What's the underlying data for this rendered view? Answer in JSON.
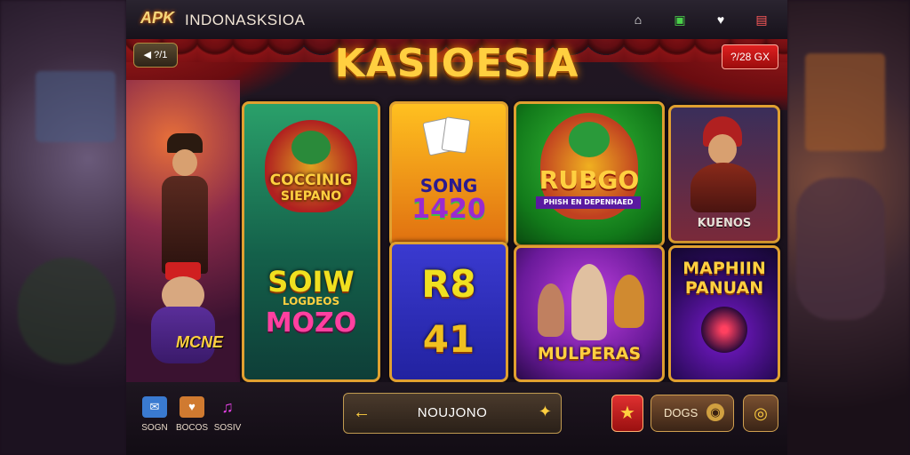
{
  "header": {
    "logo_text": "APK",
    "app_title": "INDONASKSIOA",
    "icons": [
      "home-icon",
      "chip-icon",
      "heart-icon",
      "chat-icon"
    ],
    "icon_glyphs": [
      "⌂",
      "▣",
      "♥",
      "▤"
    ]
  },
  "banner": {
    "title": "KASIOESIA",
    "back_label": "◀ ?/1",
    "promo_label": "?/28 GX"
  },
  "games": [
    {
      "name": "game-tile-coccinig",
      "lines": [
        "COCCINIG",
        "SIEPANO",
        "SOIW",
        "LOGDEOS",
        "MOZO"
      ]
    },
    {
      "name": "game-tile-song",
      "lines": [
        "SONG",
        "1420"
      ]
    },
    {
      "name": "game-tile-r8",
      "lines": [
        "R8",
        "41"
      ]
    },
    {
      "name": "game-tile-rubgo",
      "lines": [
        "RUBGO",
        "PHISH EN DEPENHAED"
      ]
    },
    {
      "name": "game-tile-mulperas",
      "lines": [
        "MULPERAS"
      ]
    },
    {
      "name": "game-tile-kuenos",
      "lines": [
        "KUENOS"
      ]
    },
    {
      "name": "game-tile-maphiin",
      "lines": [
        "MAPHIIN",
        "PANUAN"
      ]
    }
  ],
  "mascot_label": "MCNE",
  "bottom": {
    "shortcuts": [
      {
        "label": "SOGN",
        "icon": "chat-icon",
        "glyph": "✉"
      },
      {
        "label": "BOCOS",
        "icon": "gift-icon",
        "glyph": "♥"
      },
      {
        "label": "SOSIV",
        "icon": "music-icon",
        "glyph": "♫"
      }
    ],
    "search_value": "NOUJONO",
    "pill_label": "DOGS",
    "star_glyph": "★",
    "refresh_glyph": "◎"
  },
  "colors": {
    "accent_gold": "#ffcf40",
    "curtain_red": "#8e1416",
    "tile_border": "#e0a030"
  }
}
